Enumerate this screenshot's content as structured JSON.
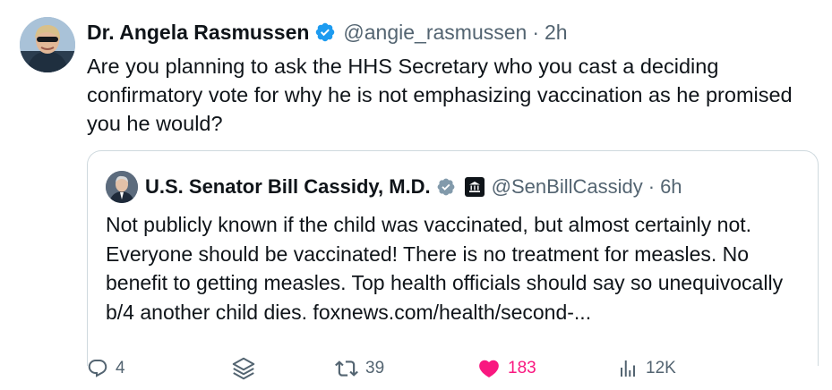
{
  "tweet": {
    "author_name": "Dr. Angela Rasmussen",
    "handle": "@angie_rasmussen",
    "time": "2h",
    "text": "Are you planning to ask the HHS Secretary who you cast a deciding confirmatory vote for why he is not emphasizing vaccination as he promised you he would?",
    "verified_badge_color": "#1d9bf0"
  },
  "quoted": {
    "author_name": "U.S. Senator Bill Cassidy, M.D.",
    "handle": "@SenBillCassidy",
    "time": "6h",
    "text": "Not publicly known if the child was vaccinated, but almost certainly not. Everyone should be vaccinated! There is no treatment for measles. No benefit to getting measles. Top health officials should say so unequivocally b/4 another child dies. foxnews.com/health/second-...",
    "verified_badge_color": "#829aab",
    "affiliation_icon": "government-building-icon"
  },
  "actions": {
    "replies": "4",
    "reposts": "39",
    "likes": "183",
    "views": "12K",
    "like_color": "#f91880"
  },
  "separator": "·"
}
